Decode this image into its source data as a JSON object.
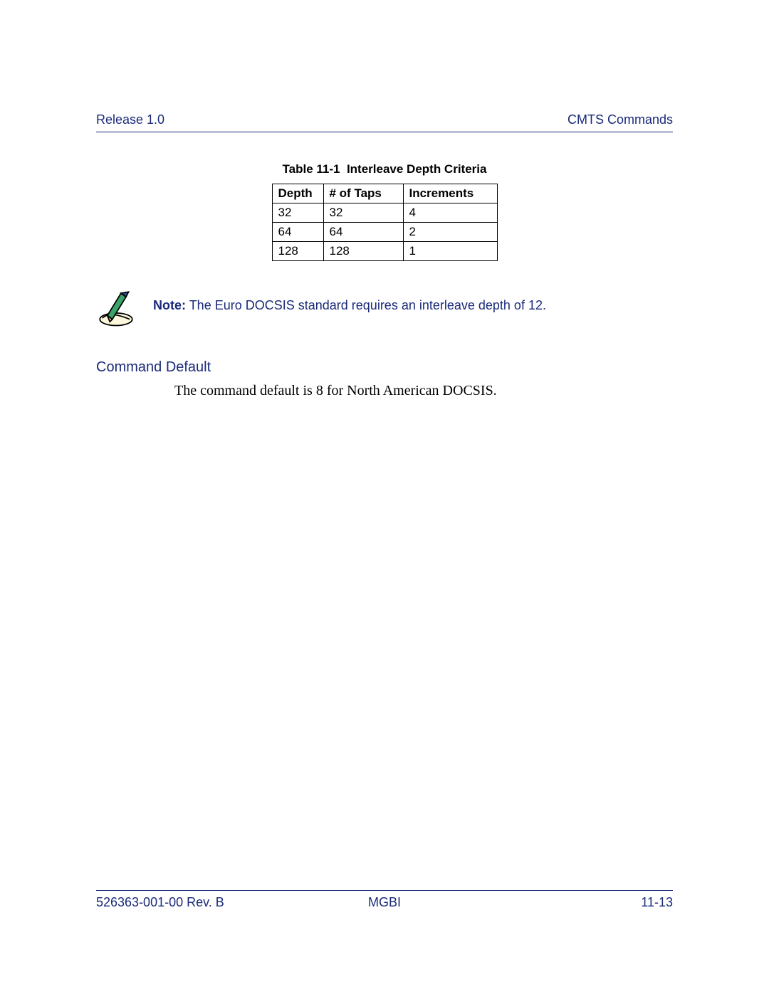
{
  "header": {
    "left": "Release 1.0",
    "right": "CMTS Commands"
  },
  "table": {
    "caption_prefix": "Table 11-1",
    "caption_title": "Interleave Depth Criteria",
    "headers": {
      "depth": "Depth",
      "taps": "# of Taps",
      "increments": "Increments"
    },
    "rows": [
      {
        "depth": "32",
        "taps": "32",
        "increments": "4"
      },
      {
        "depth": "64",
        "taps": "64",
        "increments": "2"
      },
      {
        "depth": "128",
        "taps": "128",
        "increments": "1"
      }
    ]
  },
  "note": {
    "label": "Note:",
    "text": "The Euro DOCSIS standard requires an interleave depth of 12."
  },
  "section": {
    "heading": "Command Default",
    "body": "The command default is 8 for North American DOCSIS."
  },
  "footer": {
    "left": "526363-001-00 Rev. B",
    "center": "MGBI",
    "right": "11-13"
  },
  "chart_data": {
    "type": "table",
    "title": "Table 11-1 Interleave Depth Criteria",
    "columns": [
      "Depth",
      "# of Taps",
      "Increments"
    ],
    "rows": [
      [
        32,
        32,
        4
      ],
      [
        64,
        64,
        2
      ],
      [
        128,
        128,
        1
      ]
    ]
  }
}
